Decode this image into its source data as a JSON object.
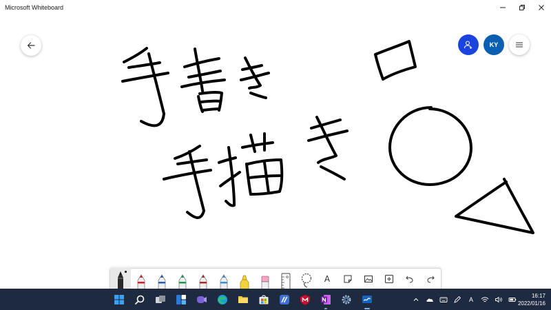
{
  "window": {
    "title": "Microsoft Whiteboard",
    "minimize_icon": "minimize-icon",
    "maximize_icon": "restore-icon",
    "close_icon": "close-icon"
  },
  "board": {
    "back_icon": "arrow-left-icon",
    "invite_icon": "person-add-icon",
    "avatar_initials": "KY",
    "menu_icon": "hamburger-icon",
    "ink_color": "#000000",
    "ink_strokes": [
      "手書き",
      "手描き",
      "square",
      "circle",
      "triangle"
    ]
  },
  "toolbar": {
    "tools": [
      {
        "name": "black-pen",
        "color": "#000000",
        "selected": true
      },
      {
        "name": "red-pen",
        "color": "#d81e2c"
      },
      {
        "name": "blue-pen",
        "color": "#1f5fbf"
      },
      {
        "name": "green-pen",
        "color": "#1a9a4a"
      },
      {
        "name": "dark-red-pen",
        "color": "#b5262a"
      },
      {
        "name": "light-blue-pen",
        "color": "#3a8fd9"
      },
      {
        "name": "yellow-highlighter",
        "color": "#f5d33a"
      },
      {
        "name": "eraser",
        "color": "#f4a6c3"
      },
      {
        "name": "ruler"
      },
      {
        "name": "lasso-select"
      }
    ],
    "text_label": "A",
    "note_icon": "sticky-note-icon",
    "image_icon": "image-icon",
    "add_icon": "add-icon",
    "undo_icon": "undo-icon",
    "redo_icon": "redo-icon"
  },
  "taskbar": {
    "apps": [
      "windows-start",
      "search",
      "task-view",
      "widgets",
      "chat",
      "edge",
      "file-explorer",
      "store",
      "linear-app",
      "mcafee",
      "onenote",
      "settings",
      "whiteboard"
    ],
    "active_app": "whiteboard",
    "tray": [
      "chevron-up-icon",
      "onedrive-icon",
      "keyboard-icon",
      "pen-icon",
      "ime-a-icon",
      "wifi-icon",
      "volume-icon",
      "battery-icon"
    ],
    "ime_label": "A",
    "time": "16:17",
    "date": "2022/01/16"
  }
}
